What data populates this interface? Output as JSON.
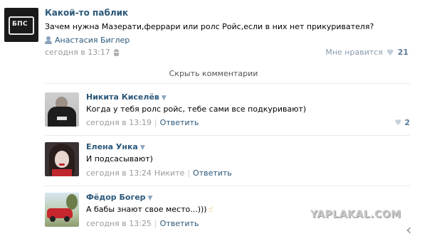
{
  "post": {
    "group_name": "Какой-то паблик",
    "avatar_text": "БПС",
    "text": "Зачем нужна Мазерати,феррари или ролс Ройс,если в них нет прикуривателя?",
    "author": "Анастасия Биглер",
    "date": "сегодня в 13:17",
    "like_label": "Мне нравится",
    "like_count": "21"
  },
  "hide_comments_label": "Скрыть комментарии",
  "comments": [
    {
      "name": "Никита Киселёв",
      "text": "Когда у тебя ролс ройс, тебе сами все подкуривают)",
      "date": "сегодня в 13:19",
      "reply_to": "",
      "reply_label": "Ответить",
      "like_count": "2"
    },
    {
      "name": "Елена Унка",
      "text": "И подсасывают)",
      "date": "сегодня в 13:24",
      "reply_to": "Никите",
      "reply_label": "Ответить",
      "like_count": ""
    },
    {
      "name": "Фёдор Богер",
      "text": "А бабы знают свое место...)))",
      "date": "сегодня в 13:25",
      "reply_to": "",
      "reply_label": "Ответить",
      "like_count": ""
    }
  ],
  "watermark": "YAPLAKAL.COM",
  "icons": {
    "author": "person-icon",
    "device": "android-icon",
    "like": "heart-icon",
    "comment_dropdown": "triangle-down-icon",
    "emoji": "pointing-hand-icon"
  },
  "colors": {
    "link": "#2b587a",
    "meta": "#999999",
    "like_heart": "#c4cfdb"
  }
}
